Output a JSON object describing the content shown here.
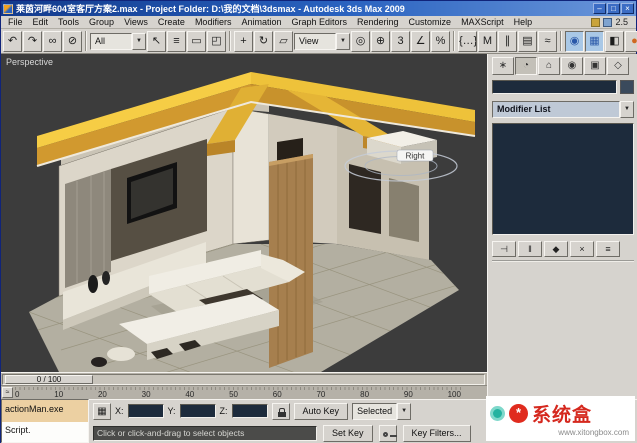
{
  "window": {
    "title": "莱茵河畔604室客厅方案2.max - Project Folder: D:\\我的文档\\3dsmax - Autodesk 3ds Max 2009"
  },
  "icons": {
    "minimize": "–",
    "maximize": "□",
    "close": "×",
    "dropdown_arrow": "▼",
    "mini_curve": "≈"
  },
  "menu": {
    "items": [
      {
        "name": "menu-file",
        "label": "File"
      },
      {
        "name": "menu-edit",
        "label": "Edit"
      },
      {
        "name": "menu-tools",
        "label": "Tools"
      },
      {
        "name": "menu-group",
        "label": "Group"
      },
      {
        "name": "menu-views",
        "label": "Views"
      },
      {
        "name": "menu-create",
        "label": "Create"
      },
      {
        "name": "menu-modifiers",
        "label": "Modifiers"
      },
      {
        "name": "menu-animation",
        "label": "Animation"
      },
      {
        "name": "menu-graph-editors",
        "label": "Graph Editors"
      },
      {
        "name": "menu-rendering",
        "label": "Rendering"
      },
      {
        "name": "menu-customize",
        "label": "Customize"
      },
      {
        "name": "menu-maxscript",
        "label": "MAXScript"
      },
      {
        "name": "menu-help",
        "label": "Help"
      }
    ],
    "extra": "2.5"
  },
  "toolbar": {
    "filter_dropdown": "All",
    "coord_dropdown": "View",
    "group1": [
      {
        "name": "undo-icon",
        "glyph": "↶"
      },
      {
        "name": "redo-icon",
        "glyph": "↷"
      },
      {
        "name": "select-and-link-icon",
        "glyph": "∞"
      },
      {
        "name": "unlink-selection-icon",
        "glyph": "⊘"
      }
    ],
    "group2": [
      {
        "name": "select-object-icon",
        "glyph": "↖"
      },
      {
        "name": "select-by-name-icon",
        "glyph": "≡"
      },
      {
        "name": "rectangular-selection-icon",
        "glyph": "▭"
      },
      {
        "name": "window-crossing-icon",
        "glyph": "◰"
      }
    ],
    "group3": [
      {
        "name": "select-and-move-icon",
        "glyph": "+"
      },
      {
        "name": "select-and-rotate-icon",
        "glyph": "↻"
      },
      {
        "name": "select-and-scale-icon",
        "glyph": "▱"
      }
    ],
    "group4": [
      {
        "name": "use-pivot-center-icon",
        "glyph": "◎"
      },
      {
        "name": "select-and-manipulate-icon",
        "glyph": "⊕"
      },
      {
        "name": "snap-toggle-icon",
        "glyph": "3"
      },
      {
        "name": "angle-snap-icon",
        "glyph": "∠"
      },
      {
        "name": "percent-snap-icon",
        "glyph": "%"
      }
    ],
    "group5": [
      {
        "name": "named-selection-sets-icon",
        "glyph": "{…}"
      },
      {
        "name": "mirror-icon",
        "glyph": "M"
      },
      {
        "name": "align-icon",
        "glyph": "∥"
      },
      {
        "name": "layer-manager-icon",
        "glyph": "▤"
      },
      {
        "name": "curve-editor-icon",
        "glyph": "≈"
      }
    ],
    "group6": [
      {
        "name": "material-editor-icon",
        "glyph": "◉",
        "active": true,
        "color": "#2a58a8"
      },
      {
        "name": "render-setup-icon",
        "glyph": "▦",
        "active": true,
        "color": "#2a58a8"
      },
      {
        "name": "render-frame-icon",
        "glyph": "◧"
      },
      {
        "name": "quick-render-icon",
        "glyph": "●",
        "color": "#d06820"
      }
    ]
  },
  "viewport": {
    "label": "Perspective",
    "gizmo_label": "Right"
  },
  "command_panel": {
    "tabs": [
      {
        "name": "tab-create",
        "glyph": "∗"
      },
      {
        "name": "tab-modify",
        "glyph": "◔",
        "active": true
      },
      {
        "name": "tab-hierarchy",
        "glyph": "⌂"
      },
      {
        "name": "tab-motion",
        "glyph": "◉"
      },
      {
        "name": "tab-display",
        "glyph": "▣"
      },
      {
        "name": "tab-utilities",
        "glyph": "◇"
      }
    ],
    "modifier_list": "Modifier List",
    "stack_buttons": [
      {
        "name": "pin-stack-icon",
        "glyph": "⊣"
      },
      {
        "name": "show-end-result-icon",
        "glyph": "‖"
      },
      {
        "name": "make-unique-icon",
        "glyph": "◆"
      },
      {
        "name": "remove-modifier-icon",
        "glyph": "×"
      },
      {
        "name": "configure-modifier-sets-icon",
        "glyph": "≡"
      }
    ]
  },
  "timeline": {
    "slider_label": "0 / 100",
    "ticks": [
      "0",
      "10",
      "20",
      "30",
      "40",
      "50",
      "60",
      "70",
      "80",
      "90",
      "100"
    ]
  },
  "status": {
    "listener_line1": "actionMan.exe",
    "listener_line2": "Script.",
    "absolute_mode_glyph": "▦",
    "x_label": "X:",
    "y_label": "Y:",
    "z_label": "Z:",
    "auto_key": "Auto Key",
    "set_key": "Set Key",
    "selected_filter": "Selected",
    "key_filters": "Key Filters...",
    "prompt": "Click or click-and-drag to select objects"
  },
  "watermark": {
    "logo_glyph": "*",
    "brand": "系统盒",
    "url": "www.xitongbox.com"
  }
}
